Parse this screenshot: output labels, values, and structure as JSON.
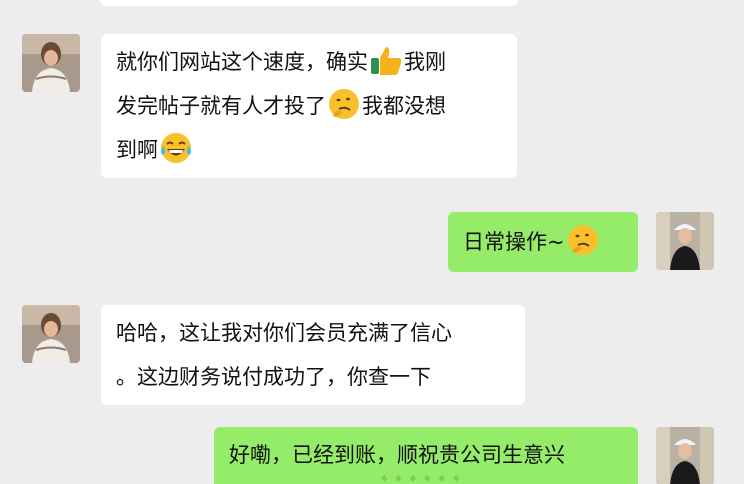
{
  "messages": [
    {
      "sender": "other",
      "segments": [
        {
          "type": "text",
          "value": "就你们网站这个速度，确实"
        },
        {
          "type": "emoji",
          "name": "thumbs-up-icon"
        },
        {
          "type": "text",
          "value": "我刚发完帖子就有人才投了"
        },
        {
          "type": "emoji",
          "name": "thinking-face-icon"
        },
        {
          "type": "text",
          "value": "我都没想到啊"
        },
        {
          "type": "emoji",
          "name": "tears-of-joy-icon"
        }
      ]
    },
    {
      "sender": "me",
      "segments": [
        {
          "type": "text",
          "value": "日常操作~"
        },
        {
          "type": "emoji",
          "name": "thinking-face-icon"
        }
      ]
    },
    {
      "sender": "other",
      "segments": [
        {
          "type": "text",
          "value": "哈哈，这让我对你们会员充满了信心。这边财务说付成功了，你查一下"
        }
      ]
    },
    {
      "sender": "me",
      "segments": [
        {
          "type": "text",
          "value": "好嘞，已经到账，顺祝贵公司生意兴"
        }
      ]
    }
  ],
  "colors": {
    "background": "#ededed",
    "incoming_bubble": "#ffffff",
    "outgoing_bubble": "#95ec69",
    "text": "#111111"
  },
  "text": {
    "m1_a": "就你们网站这个速度，确实",
    "m1_b": "我刚",
    "m1_c": "发完帖子就有人才投了",
    "m1_d": "我都没想",
    "m1_e": "到啊",
    "m2_a": "日常操作~",
    "m3_a": "哈哈，这让我对你们会员充满了信心",
    "m3_b": "。这边财务说付成功了，你查一下",
    "m4_a": "好嘞，已经到账，顺祝贵公司生意兴"
  }
}
